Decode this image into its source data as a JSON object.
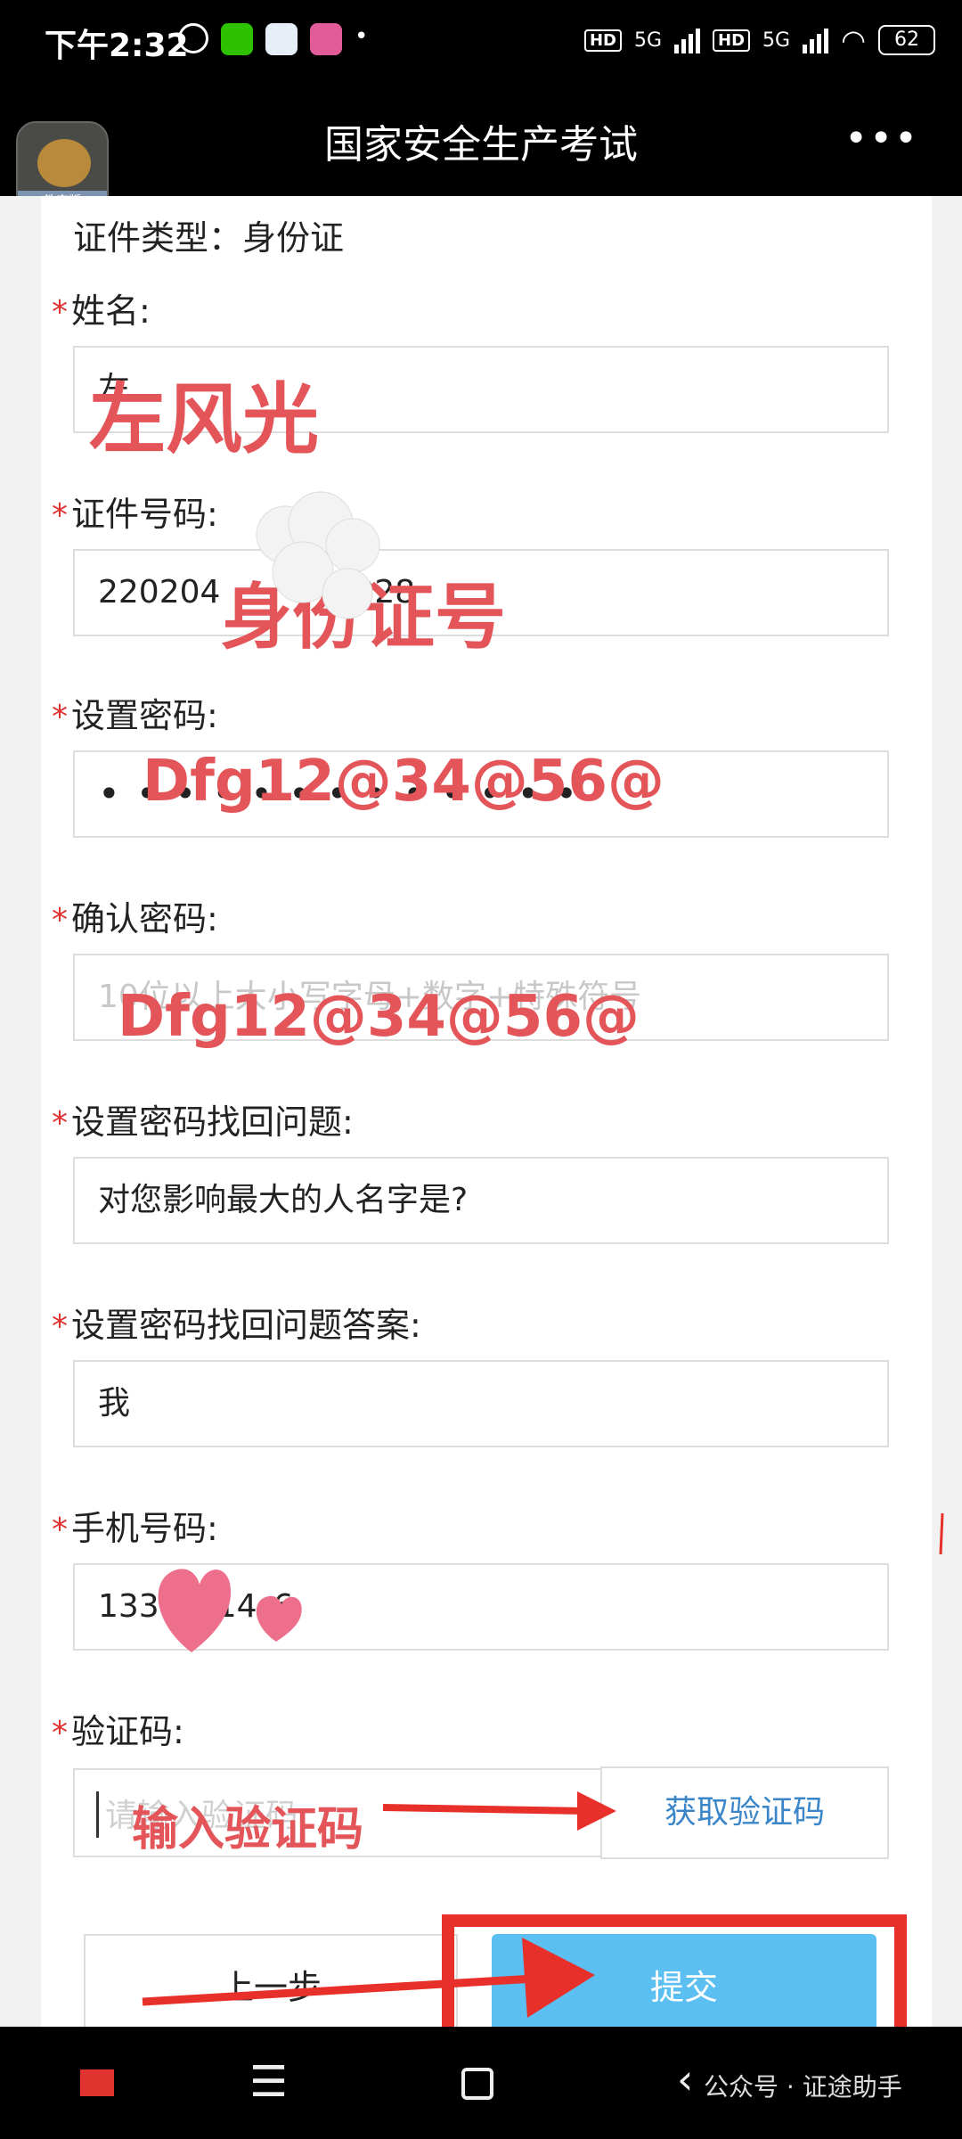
{
  "status": {
    "time": "下午2:32",
    "network_1": "5G",
    "network_2": "5G",
    "hd": "HD",
    "battery": "62"
  },
  "header": {
    "title": "国家安全生产考试",
    "badge_label": "教育版"
  },
  "form": {
    "id_type": "证件类型：身份证",
    "star": "*",
    "name_label": "姓名:",
    "name_value": "左",
    "id_label": "证件号码:",
    "id_value": "220204",
    "id_value_tail": "028",
    "password_label": "设置密码:",
    "password_dots": "•••••••••••••",
    "confirm_label": "确认密码:",
    "confirm_placeholder": "10位以上大小写字母+数字+特殊符号",
    "question_label": "设置密码找回问题:",
    "question_value": "对您影响最大的人名字是?",
    "answer_label": "设置密码找回问题答案:",
    "answer_value": "我",
    "phone_label": "手机号码:",
    "phone_value_a": "133",
    "phone_value_b": "14",
    "phone_value_c": "6",
    "code_label": "验证码:",
    "code_placeholder": "请输入验证码",
    "get_code_button": "获取验证码",
    "prev_button": "上一步",
    "submit_button": "提交"
  },
  "annotations": {
    "name": "左风光",
    "id": "身份证号",
    "password": "Dfg12@34@56@",
    "confirm": "Dfg12@34@56@",
    "code": "输入验证码"
  },
  "watermark": "公众号 · 证途助手",
  "colors": {
    "annotation": "#e4555a",
    "arrow": "#e8302a",
    "required_star": "#e0322f",
    "submit_bg": "#5cbff2",
    "link_blue": "#3a86c8"
  }
}
